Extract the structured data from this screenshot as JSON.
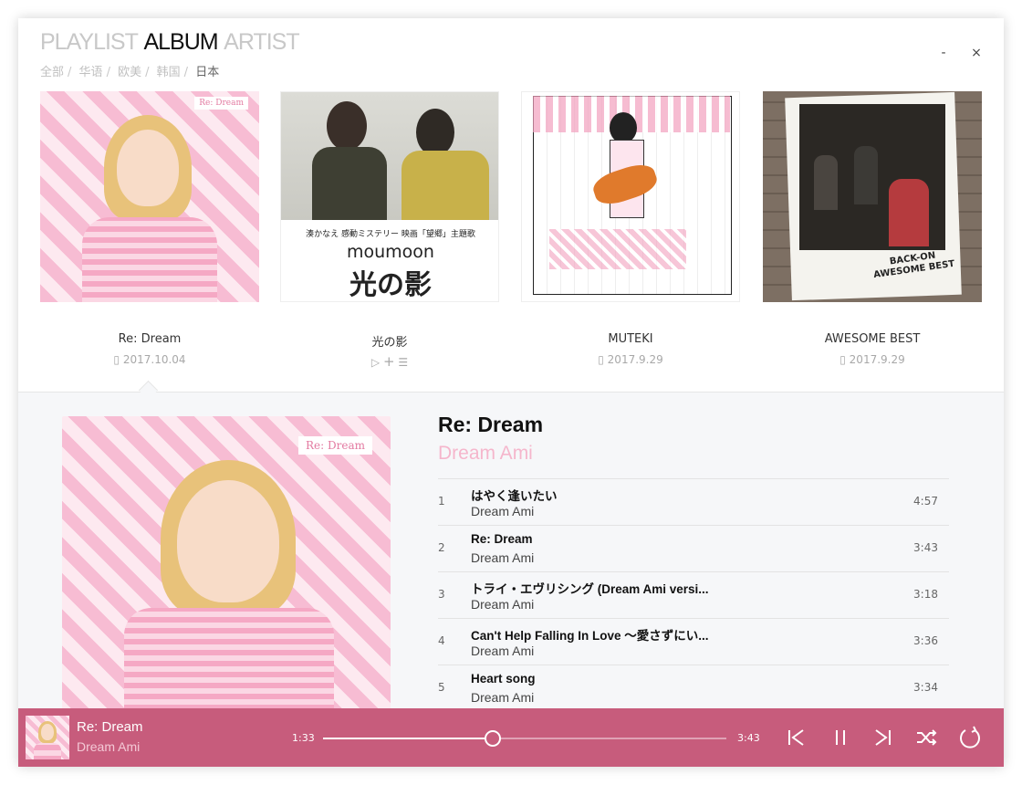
{
  "nav": {
    "tabs": [
      "PLAYLIST",
      "ALBUM",
      "ARTIST"
    ],
    "active_tab": "ALBUM"
  },
  "filters": [
    "全部",
    "华语",
    "欧美",
    "韩国",
    "日本"
  ],
  "active_filter": "日本",
  "window": {
    "minimize": "-",
    "close": "×"
  },
  "albums": [
    {
      "title": "Re: Dream",
      "date": "2017.10.04",
      "cover_stamp": "Re: Dream"
    },
    {
      "title": "光の影",
      "date": "",
      "cover_band": "湊かなえ 感動ミステリー 映画「望郷」主題歌",
      "cover_artist": "moumoon",
      "cover_title": "光の影"
    },
    {
      "title": "MUTEKI",
      "date": "2017.9.29"
    },
    {
      "title": "AWESOME BEST",
      "date": "2017.9.29",
      "cover_text": "BACK-ON AWESOME BEST"
    }
  ],
  "detail": {
    "title": "Re: Dream",
    "artist": "Dream Ami",
    "cover_stamp": "Re: Dream",
    "tracks": [
      {
        "num": "1",
        "name": "はやく逢いたい",
        "artist": "Dream Ami",
        "duration": "4:57"
      },
      {
        "num": "2",
        "name": "Re: Dream",
        "artist": "Dream Ami",
        "duration": "3:43"
      },
      {
        "num": "3",
        "name": "トライ・エヴリシング (Dream Ami versi...",
        "artist": "Dream Ami",
        "duration": "3:18"
      },
      {
        "num": "4",
        "name": "Can't Help Falling In Love ～愛さずにい...",
        "artist": "Dream Ami",
        "duration": "3:36"
      },
      {
        "num": "5",
        "name": "Heart song",
        "artist": "Dream Ami",
        "duration": "3:34"
      }
    ]
  },
  "player": {
    "title": "Re: Dream",
    "artist": "Dream Ami",
    "elapsed": "1:33",
    "total": "3:43",
    "progress": 0.42
  },
  "colors": {
    "accent": "#c75c7c",
    "pink": "#f5b6cc"
  }
}
